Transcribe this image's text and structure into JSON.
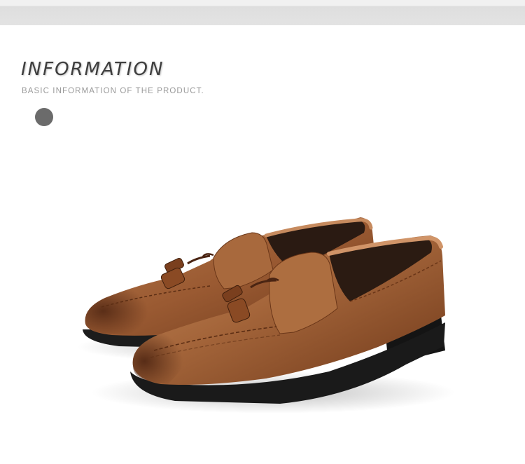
{
  "section": {
    "title": "INFORMATION",
    "subtitle": "BASIC INFORMATION OF THE PRODUCT."
  },
  "product": {
    "image_label": "brown tassel loafers pair",
    "color": "#9a5a32"
  },
  "icons": {
    "bullet": "circle-bullet-icon"
  }
}
